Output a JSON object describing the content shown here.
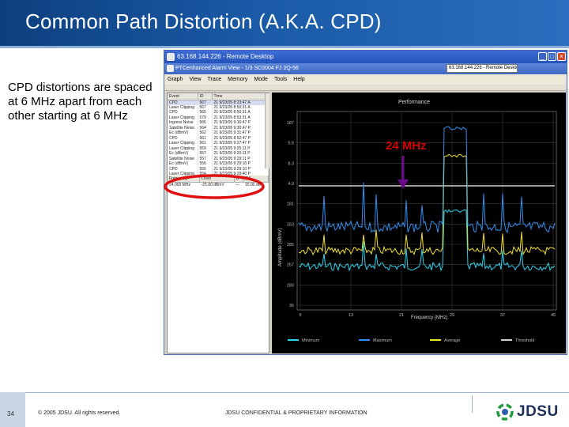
{
  "slide": {
    "title": "Common Path Distortion (A.K.A. CPD)",
    "body_text": "CPD distortions are spaced at 6 MHz apart from each other starting at 6 MHz"
  },
  "screenshot": {
    "remote_desktop_title": "63.168.144.226 - Remote Desktop",
    "app_title": "PTCenhanced Alarm View - 1/3 SC0004 FJ 2Q-56",
    "nested_title": "63.168.144.226 - Remote Desktop",
    "menu": [
      "Graph",
      "View",
      "Trace",
      "Memory",
      "Mode",
      "Tools",
      "Help"
    ],
    "event_table": {
      "headers": [
        "Event",
        "ID",
        "Time"
      ],
      "rows": [
        [
          "CPD",
          "567",
          "21 9/23/05 8:23:47 A"
        ],
        [
          "Laser Clipping",
          "567",
          "21 9/23/05 8:50:31 A"
        ],
        [
          "CPD",
          "565",
          "21 9/23/05 8:50:31 A"
        ],
        [
          "Laser Clipping",
          "579",
          "21 9/23/05 8:53:31 A"
        ],
        [
          "Ingress Noise",
          "565",
          "21 9/23/05 9:16:47 P"
        ],
        [
          "Satellite Noise",
          "564",
          "21 9/23/05 9:30:47 P"
        ],
        [
          "Ec (dBmV)",
          "562",
          "21 9/23/05 9:31:47 P"
        ],
        [
          "CPD",
          "561",
          "21 9/23/05 8:52:47 P"
        ],
        [
          "Laser Clipping",
          "561",
          "21 9/23/05 9:27:47 P"
        ],
        [
          "Laser Clipping",
          "559",
          "21 9/23/05 9:25:11 P"
        ],
        [
          "Ec (dBmV)",
          "557",
          "21 9/23/05 9:20:11 P"
        ],
        [
          "Satellite Noise",
          "557",
          "21 9/23/05 9:29:11 P"
        ],
        [
          "Ec (dBmV)",
          "556",
          "21 9/23/05 9:29:10 P"
        ],
        [
          "CPD",
          "555",
          "21 9/23/05 9:29:10 P"
        ],
        [
          "Laser Clipping",
          "554",
          "21 9/23/05 9:29:40 P"
        ],
        [
          "Ec (dBmV)",
          "552",
          "21 9/23/05 9:29:40 P"
        ]
      ]
    },
    "marker_table": {
      "headers": [
        "Frequency",
        "Level",
        "Δ",
        "C/I"
      ],
      "rows": [
        [
          "24.000 MHz",
          "-25.00 dBmV",
          "---",
          "15.00 dB"
        ]
      ]
    },
    "chart": {
      "title": "Performance",
      "y_label": "Amplitude (dBmV)",
      "x_label": "Frequency (MHz)",
      "y_ticks": [
        "187",
        "5.5",
        "8.3",
        "4.9",
        "181",
        "153",
        "285",
        "257",
        "283",
        "35"
      ],
      "x_ticks": [
        "5",
        "13",
        "21",
        "29",
        "37",
        "45"
      ],
      "legend": [
        "Minimum",
        "Maximum",
        "Average",
        "Threshold"
      ],
      "colors": {
        "minimum": "#2ad4ee",
        "maximum": "#2f8ff0",
        "average": "#f2e02a",
        "threshold": "#cfcfcf",
        "background": "#000000"
      }
    }
  },
  "annotation": {
    "label": "24 MHz",
    "color": "#d40000"
  },
  "footer": {
    "page_number": "34",
    "copyright": "© 2005 JDSU. All rights reserved.",
    "confidential": "JDSU CONFIDENTIAL & PROPRIETARY INFORMATION",
    "logo_text": "JDSU"
  },
  "theme": {
    "header_blue": "#1a5aa6",
    "logo_navy": "#1f2f57"
  }
}
